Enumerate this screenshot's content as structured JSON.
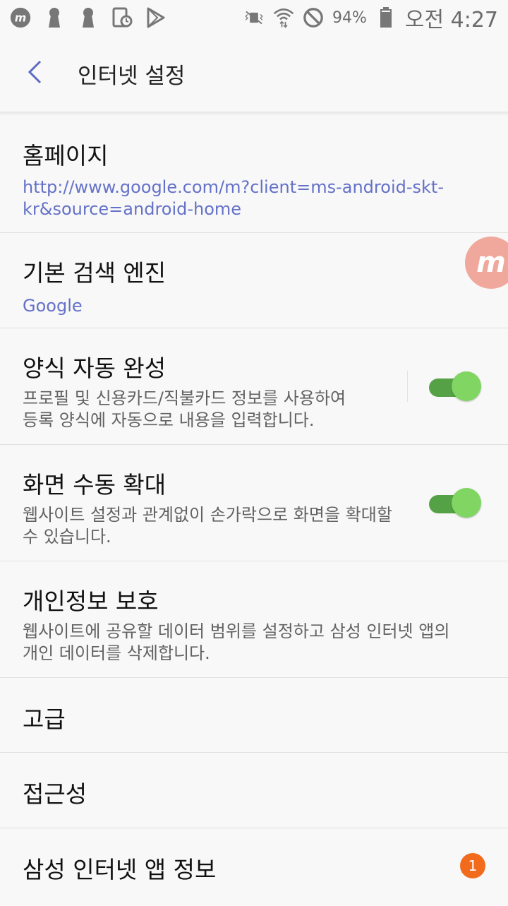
{
  "status_bar": {
    "left_icons": [
      "mobizen-icon",
      "keyhole-icon",
      "keyhole-icon-2",
      "screen-timer-icon",
      "play-store-icon"
    ],
    "right_icons": [
      "vibrate-mute-icon",
      "wifi-icon",
      "do-not-disturb-icon",
      "battery-icon"
    ],
    "battery": "94%",
    "time": "오전 4:27"
  },
  "app_bar": {
    "title": "인터넷 설정"
  },
  "settings": [
    {
      "title": "홈페이지",
      "subtitle": "http://www.google.com/m?client=ms-android-skt-kr&source=android-home"
    },
    {
      "title": "기본 검색 엔진",
      "subtitle": "Google"
    },
    {
      "title": "양식 자동 완성",
      "subtitle": "프로필 및 신용카드/직불카드 정보를 사용하여 등록 양식에 자동으로 내용을 입력합니다.",
      "toggle_on": true
    },
    {
      "title": "화면 수동 확대",
      "subtitle": "웹사이트 설정과 관계없이 손가락으로 화면을 확대할 수 있습니다.",
      "toggle_on": true
    },
    {
      "title": "개인정보 보호",
      "subtitle": "웹사이트에 공유할 데이터 범위를 설정하고 삼성 인터넷 앱의 개인 데이터를 삭제합니다."
    },
    {
      "title": "고급"
    },
    {
      "title": "접근성"
    },
    {
      "title": "삼성 인터넷 앱 정보",
      "badge": "1"
    }
  ],
  "floating_button": {
    "label": "m"
  },
  "colors": {
    "accent": "#6471c8",
    "toggle_track": "#55a246",
    "toggle_knob": "#80d563",
    "badge": "#f26b1d"
  }
}
